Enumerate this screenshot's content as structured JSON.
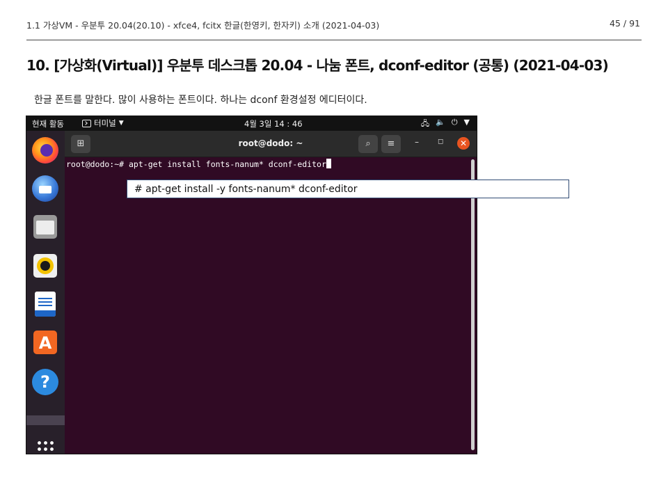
{
  "header": {
    "left": "1.1 가상VM - 우분투 20.04(20.10) - xfce4, fcitx 한글(한영키, 한자키) 소개 (2021-04-03)",
    "page": "45 / 91"
  },
  "section_title": "10. [가상화(Virtual)] 우분투 데스크톱 20.04 - 나눔 폰트, dconf-editor (공통) (2021-04-03)",
  "intro": "한글 폰트를 말한다. 많이 사용하는 폰트이다. 하나는 dconf 환경설정 에디터이다.",
  "screenshot": {
    "topbar": {
      "activities": "현재 활동",
      "terminal_menu": "터미널",
      "clock": "4월 3일  14 : 46"
    },
    "dock": {
      "items": [
        "firefox-icon",
        "thunderbird-icon",
        "files-icon",
        "rhythmbox-icon",
        "libreoffice-writer-icon",
        "ubuntu-software-icon",
        "help-icon",
        "show-applications-icon"
      ]
    },
    "terminal": {
      "title": "root@dodo: ~",
      "command_line": "root@dodo:~# apt-get install fonts-nanum* dconf-editor"
    },
    "accent_color": "#e95420",
    "terminal_bg": "#300a24"
  },
  "callout": {
    "text": "# apt-get install -y fonts-nanum* dconf-editor"
  }
}
